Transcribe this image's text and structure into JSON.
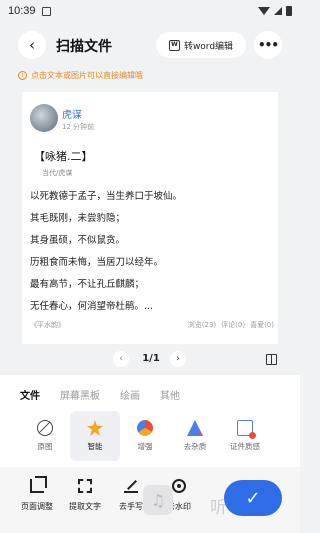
{
  "status_bar": {
    "time": "10:39"
  },
  "header": {
    "title": "扫描文件",
    "word_button_label": "转word编辑",
    "back_icon": "chevron-left-icon",
    "more_icon": "more-dots-icon"
  },
  "tip": {
    "text": "点击文本或图片可以直接编辑哦"
  },
  "document": {
    "author": "虎谋",
    "posted": "12 分钟前",
    "poem_title": "【咏猪.二】",
    "dynasty": "当代/虎谋",
    "lines": [
      "以死教德于孟子，当生养口于坡仙。",
      "其毛既刚，未尝豹隐；",
      "其身虽硕，不似鼠贪。",
      "历粗食而未悔，当居刀以经年。",
      "最有高节，不让孔丘麒麟；",
      "无任春心，何消望帝杜鹃。..."
    ],
    "footer_tag": "《平水韵》",
    "views": "浏览(23)",
    "comments": "评论(0)",
    "likes": "喜爱(0)"
  },
  "pager": {
    "page": "1/1",
    "prev": "‹",
    "next": "›"
  },
  "filter_panel": {
    "tabs": [
      "文件",
      "屏幕黑板",
      "绘画",
      "其他"
    ],
    "filters": [
      "原图",
      "智能",
      "增强",
      "去杂质",
      "证件质感"
    ]
  },
  "bottom_toolbar": {
    "tools": [
      "页面调整",
      "提取文字",
      "去手写",
      "去水印"
    ],
    "confirm_icon": "check-icon",
    "watermark_text": "听下载"
  },
  "colors": {
    "accent": "#2f6de6",
    "tip": "#e98a1f",
    "link": "#3a76c4"
  }
}
